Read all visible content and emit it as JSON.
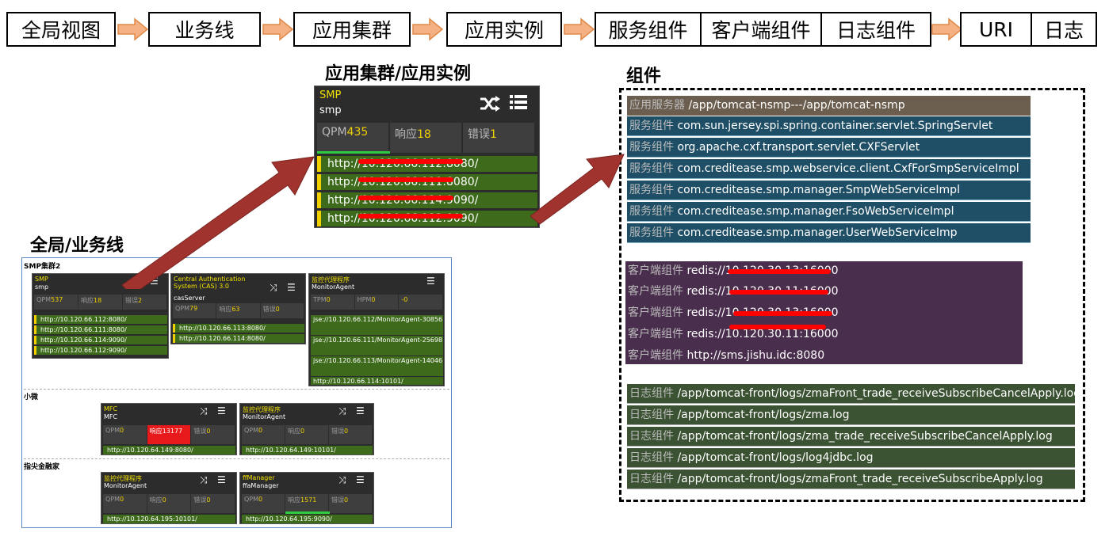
{
  "flow": {
    "steps": [
      "全局视图",
      "业务线",
      "应用集群",
      "应用实例"
    ],
    "components": [
      "服务组件",
      "客户端组件",
      "日志组件"
    ],
    "ends": [
      "URI",
      "日志"
    ]
  },
  "titles": {
    "cluster_instance": "应用集群/应用实例",
    "components": "组件",
    "global": "全局/业务线"
  },
  "big_card": {
    "name": "SMP",
    "sub": "smp",
    "stats": [
      {
        "label": "QPM",
        "value": "435"
      },
      {
        "label": "响应",
        "value": "18"
      },
      {
        "label": "错误",
        "value": "1"
      }
    ],
    "rows": [
      "http://10.120.66.112:8080/",
      "http://10.120.66.111:8080/",
      "http://10.120.66.114:9090/",
      "http://10.120.66.112:9090/"
    ]
  },
  "components_panel": {
    "server": {
      "label": "应用服务器",
      "value": "/app/tomcat-nsmp---/app/tomcat-nsmp"
    },
    "services_label": "服务组件",
    "services": [
      "com.sun.jersey.spi.spring.container.servlet.SpringServlet",
      "org.apache.cxf.transport.servlet.CXFServlet",
      "com.creditease.smp.webservice.client.CxfForSmpServiceImpl",
      "com.creditease.smp.manager.SmpWebServiceImpl",
      "com.creditease.smp.manager.FsoWebServiceImpl",
      "com.creditease.smp.manager.UserWebServiceImp"
    ],
    "clients_label": "客户端组件",
    "clients": [
      "redis://10.120.30.13:16000",
      "redis://10.120.30.11:16000",
      "redis://10.120.30.13:16000",
      "redis://10.120.30.11:16000",
      "http://sms.jishu.idc:8080"
    ],
    "logs_label": "日志组件",
    "logs": [
      "/app/tomcat-front/logs/zmaFront_trade_receiveSubscribeCancelApply.log",
      "/app/tomcat-front/logs/zma.log",
      "/app/tomcat-front/logs/zma_trade_receiveSubscribeCancelApply.log",
      "/app/tomcat-front/logs/log4jdbc.log",
      "/app/tomcat-front/logs/zmaFront_trade_receiveSubscribeApply.log"
    ]
  },
  "dashboard": {
    "groups": [
      "SMP集群2",
      "小微",
      "指尖金融家"
    ],
    "smp": {
      "name": "SMP",
      "sub": "smp",
      "stats": [
        {
          "label": "QPM",
          "value": "537"
        },
        {
          "label": "响应",
          "value": "18"
        },
        {
          "label": "错误",
          "value": "2"
        }
      ],
      "rows": [
        "http://10.120.66.112:8080/",
        "http://10.120.66.111:8080/",
        "http://10.120.66.114:9090/",
        "http://10.120.66.112:9090/"
      ]
    },
    "cas": {
      "name": "Central Authentication System (CAS) 3.0",
      "sub": "casServer",
      "stats": [
        {
          "label": "QPM",
          "value": "79"
        },
        {
          "label": "响应",
          "value": "63"
        },
        {
          "label": "错误",
          "value": "0"
        }
      ],
      "rows": [
        "http://10.120.66.113:8080/",
        "http://10.120.66.114:8080/"
      ]
    },
    "agent1": {
      "name": "监控代理程序",
      "sub": "MonitorAgent",
      "stats": [
        {
          "label": "TPM",
          "value": "0"
        },
        {
          "label": "HPM",
          "value": "0"
        },
        {
          "label": "",
          "value": "-0"
        }
      ],
      "rows": [
        "jse://10.120.66.112/MonitorAgent-30856",
        "jse://10.120.66.111/MonitorAgent-25698",
        "jse://10.120.66.113/MonitorAgent-14046",
        "http://10.120.66.114:10101/"
      ]
    },
    "mfc": {
      "name": "MFC",
      "sub": "MFC",
      "stats": [
        {
          "label": "QPM",
          "value": "0"
        },
        {
          "label": "响应",
          "value": "13177"
        },
        {
          "label": "错误",
          "value": "0"
        }
      ],
      "rows": [
        "http://10.120.64.149:8080/"
      ]
    },
    "agent2": {
      "name": "监控代理程序",
      "sub": "MonitorAgent",
      "stats": [
        {
          "label": "QPM",
          "value": "0"
        },
        {
          "label": "响应",
          "value": "0"
        },
        {
          "label": "错误",
          "value": "0"
        }
      ],
      "rows": [
        "http://10.120.64.149:10101/"
      ]
    },
    "agent3": {
      "name": "监控代理程序",
      "sub": "MonitorAgent",
      "stats": [
        {
          "label": "QPM",
          "value": "0"
        },
        {
          "label": "响应",
          "value": "0"
        },
        {
          "label": "错误",
          "value": "0"
        }
      ],
      "rows": [
        "http://10.120.64.195:10101/"
      ]
    },
    "ffa": {
      "name": "ffManager",
      "sub": "ffaManager",
      "stats": [
        {
          "label": "QPM",
          "value": "0"
        },
        {
          "label": "响应",
          "value": "1571"
        },
        {
          "label": "错误",
          "value": "0"
        }
      ],
      "rows": [
        "http://10.120.64.195:9090/"
      ]
    }
  },
  "colors": {
    "arrow": "#a0332e",
    "flow_arrow": "#f4b183",
    "accent": "#f0d000"
  }
}
